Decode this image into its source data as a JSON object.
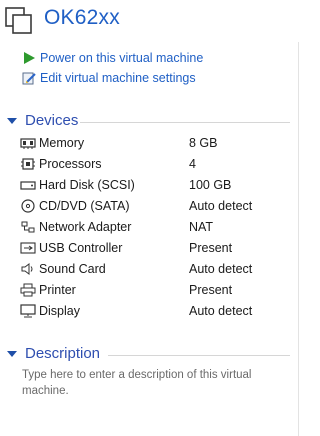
{
  "vm": {
    "name": "OK62xx"
  },
  "commands": [
    {
      "label": "Power on this virtual machine",
      "icon": "play-icon"
    },
    {
      "label": "Edit virtual machine settings",
      "icon": "edit-settings-icon"
    }
  ],
  "devices": {
    "title": "Devices",
    "items": [
      {
        "name": "Memory",
        "value": "8 GB",
        "icon": "memory-icon"
      },
      {
        "name": "Processors",
        "value": "4",
        "icon": "processor-icon"
      },
      {
        "name": "Hard Disk (SCSI)",
        "value": "100 GB",
        "icon": "hard-disk-icon"
      },
      {
        "name": "CD/DVD (SATA)",
        "value": "Auto detect",
        "icon": "cd-dvd-icon"
      },
      {
        "name": "Network Adapter",
        "value": "NAT",
        "icon": "network-adapter-icon"
      },
      {
        "name": "USB Controller",
        "value": "Present",
        "icon": "usb-icon"
      },
      {
        "name": "Sound Card",
        "value": "Auto detect",
        "icon": "sound-icon"
      },
      {
        "name": "Printer",
        "value": "Present",
        "icon": "printer-icon"
      },
      {
        "name": "Display",
        "value": "Auto detect",
        "icon": "display-icon"
      }
    ]
  },
  "description": {
    "title": "Description",
    "placeholder": "Type here to enter a description of this virtual machine."
  },
  "colors": {
    "accent": "#1f5fc5",
    "section": "#2f4fb0",
    "play": "#2e9a2e"
  }
}
